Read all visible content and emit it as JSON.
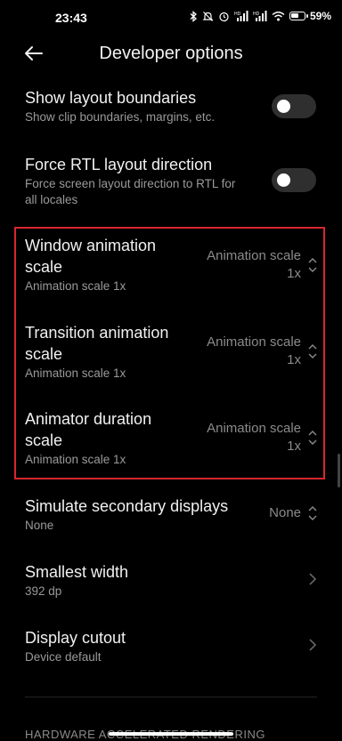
{
  "status_bar": {
    "time": "23:43",
    "battery_percent": "59%",
    "icons": [
      "bluetooth-icon",
      "mute-icon",
      "alarm-icon",
      "hd-signal-icon",
      "hd-signal-icon",
      "wifi-icon",
      "battery-icon"
    ]
  },
  "header": {
    "title": "Developer options",
    "back_icon": "arrow-left-icon"
  },
  "settings": [
    {
      "title": "Show layout boundaries",
      "subtitle": "Show clip boundaries, margins, etc.",
      "toggle": "off"
    },
    {
      "title": "Force RTL layout direction",
      "subtitle_lines": [
        "Force screen layout direction to RTL for",
        "all locales"
      ],
      "toggle": "off"
    },
    {
      "title_lines": [
        "Window animation",
        "scale"
      ],
      "subtitle": "Animation scale 1x",
      "value_lines": [
        "Animation scale",
        "1x"
      ]
    },
    {
      "title_lines": [
        "Transition animation",
        "scale"
      ],
      "subtitle": "Animation scale 1x",
      "value_lines": [
        "Animation scale",
        "1x"
      ]
    },
    {
      "title_lines": [
        "Animator duration",
        "scale"
      ],
      "subtitle": "Animation scale 1x",
      "value_lines": [
        "Animation scale",
        "1x"
      ]
    },
    {
      "title": "Simulate secondary displays",
      "subtitle": "None",
      "value": "None"
    },
    {
      "title": "Smallest width",
      "subtitle": "392 dp"
    },
    {
      "title": "Display cutout",
      "subtitle": "Device default"
    }
  ],
  "section_header": "HARDWARE ACCELERATED RENDERING",
  "colors": {
    "highlight_border": "#d8262f",
    "background": "#000000"
  }
}
